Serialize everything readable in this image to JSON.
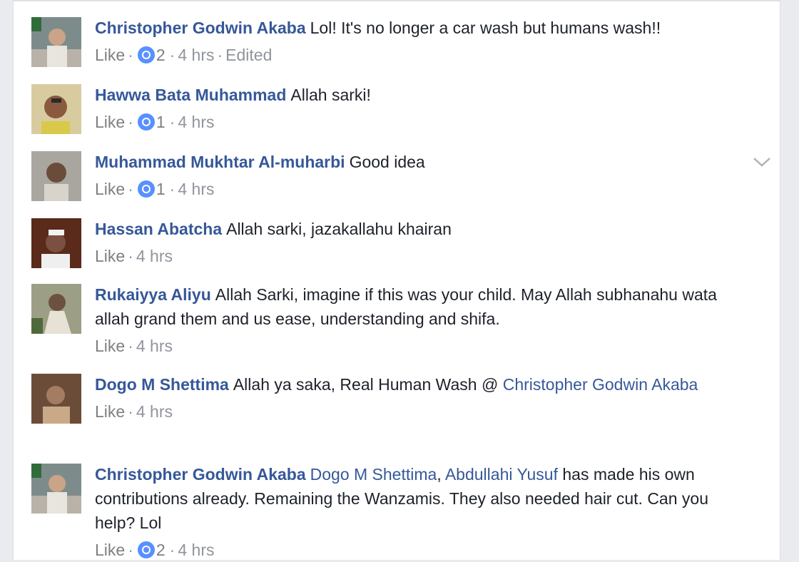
{
  "comments": [
    {
      "author": "Christopher Godwin Akaba",
      "text": "Lol! It's no longer a car wash but humans wash!!",
      "like_label": "Like",
      "reactions": "2",
      "time": "4 hrs",
      "edited": "Edited"
    },
    {
      "author": "Hawwa Bata Muhammad",
      "text": "Allah sarki!",
      "like_label": "Like",
      "reactions": "1",
      "time": "4 hrs"
    },
    {
      "author": "Muhammad Mukhtar Al-muharbi",
      "text": "Good idea",
      "like_label": "Like",
      "reactions": "1",
      "time": "4 hrs"
    },
    {
      "author": "Hassan Abatcha",
      "text": "Allah sarki, jazakallahu khairan",
      "like_label": "Like",
      "time": "4 hrs"
    },
    {
      "author": "Rukaiyya Aliyu",
      "text": "Allah Sarki, imagine if this was your child. May Allah subhanahu wata allah grand them and us ease, understanding and shifa.",
      "like_label": "Like",
      "time": "4 hrs"
    },
    {
      "author": "Dogo M Shettima",
      "text": "Allah ya saka, Real Human Wash @",
      "mention": "Christopher Godwin Akaba",
      "like_label": "Like",
      "time": "4 hrs"
    },
    {
      "author": "Christopher Godwin Akaba",
      "text_mention_1": "Dogo M Shettima",
      "text_sep": ",",
      "text_mention_2": "Abdullahi Yusuf",
      "text": "has made his own contributions already. Remaining the Wanzamis. They also needed hair cut. Can you help? Lol",
      "like_label": "Like",
      "reactions": "2",
      "time": "4 hrs"
    }
  ],
  "separator": "·",
  "colors": {
    "author_link": "#365899",
    "body_text": "#1d2129",
    "meta_text": "#90949c",
    "reaction_blue": "#5890ff"
  },
  "icons": {
    "reaction": "like-reaction-icon",
    "options": "chevron-down-icon"
  }
}
